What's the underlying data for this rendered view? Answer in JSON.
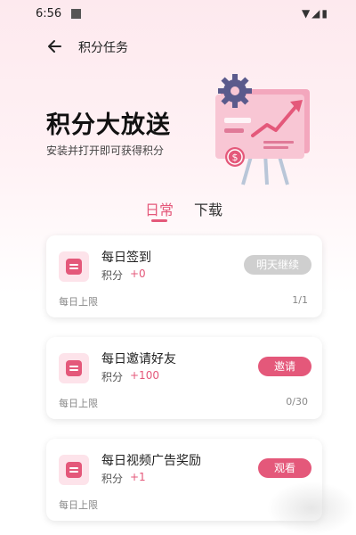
{
  "status": {
    "time": "6:56",
    "icons": "▼◢▮"
  },
  "header": {
    "back_icon": "arrow-left-icon",
    "title": "积分任务"
  },
  "banner": {
    "title": "积分大放送",
    "subtitle": "安装并打开即可获得积分",
    "illustration_icon": "chart-board-icon"
  },
  "tabs": [
    {
      "label": "日常",
      "active": true
    },
    {
      "label": "下载",
      "active": false
    }
  ],
  "tasks": [
    {
      "title": "每日签到",
      "points_label": "积分",
      "points_value": "+0",
      "action_label": "明天继续",
      "action_enabled": false,
      "limit_label": "每日上限",
      "limit_value": "1/1"
    },
    {
      "title": "每日邀请好友",
      "points_label": "积分",
      "points_value": "+100",
      "action_label": "邀请",
      "action_enabled": true,
      "limit_label": "每日上限",
      "limit_value": "0/30"
    },
    {
      "title": "每日视频广告奖励",
      "points_label": "积分",
      "points_value": "+1",
      "action_label": "观看",
      "action_enabled": true,
      "limit_label": "每日上限",
      "limit_value": ""
    }
  ],
  "colors": {
    "accent": "#e4587a",
    "disabled": "#cfcfcf",
    "background_top": "#fde9ee"
  }
}
